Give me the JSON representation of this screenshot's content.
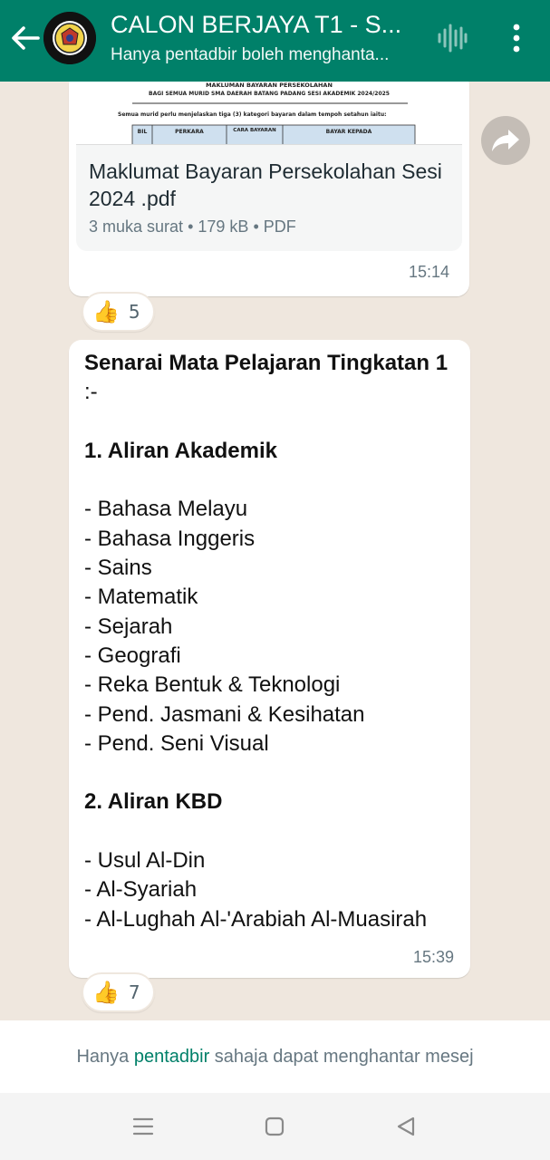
{
  "header": {
    "title": "CALON BERJAYA T1 - S...",
    "subtitle": "Hanya pentadbir boleh menghanta...",
    "colors": {
      "bar": "#008069"
    }
  },
  "doc_message": {
    "preview_lines": [
      "MAKLUMAN BAYARAN PERSEKOLAHAN",
      "BAGI SEMUA MURID SMA DAERAH BATANG PADANG SESI AKADEMIK 2024/2025",
      "Semua murid perlu menjelaskan tiga (3) kategori bayaran dalam tempoh setahun iaitu:"
    ],
    "preview_table_headers": [
      "BIL",
      "PERKARA",
      "CARA BAYARAN",
      "BAYAR KEPADA"
    ],
    "file_name": "Maklumat Bayaran Persekolahan Sesi 2024 .pdf",
    "pages": "3 muka surat",
    "size": "179 kB",
    "type": "PDF",
    "time": "15:14",
    "reaction_emoji": "👍",
    "reaction_count": "5"
  },
  "text_message": {
    "heading": "Senarai Mata Pelajaran Tingkatan 1",
    "heading_suffix": " :-",
    "section1_title": "1. Aliran Akademik",
    "section1_items": [
      "- Bahasa Melayu",
      "- Bahasa Inggeris",
      "- Sains",
      "- Matematik",
      "- Sejarah",
      "- Geografi",
      "- Reka Bentuk & Teknologi",
      "- Pend. Jasmani & Kesihatan",
      "- Pend. Seni Visual"
    ],
    "section2_title": "2. Aliran KBD",
    "section2_items": [
      "- Usul Al-Din",
      "- Al-Syariah",
      "- Al-Lughah Al-'Arabiah Al-Muasirah"
    ],
    "time": "15:39",
    "reaction_emoji": "👍",
    "reaction_count": "7"
  },
  "footer": {
    "part1": "Hanya ",
    "highlight": "pentadbir",
    "part2": " sahaja dapat menghantar mesej"
  },
  "icons": {
    "back": "arrow-left-icon",
    "voice": "waveform-icon",
    "menu": "more-vertical-icon",
    "forward": "forward-arrow-icon",
    "nav": [
      "menu-lines-icon",
      "square-home-icon",
      "triangle-back-icon"
    ]
  }
}
